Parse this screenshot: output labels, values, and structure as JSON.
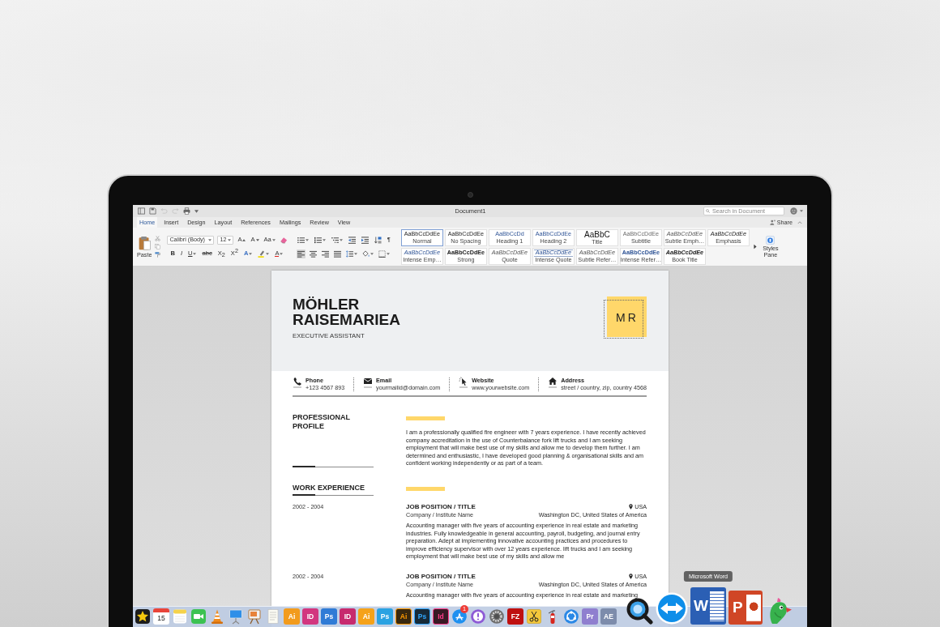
{
  "window": {
    "title": "Document1",
    "search_placeholder": "Search in Document"
  },
  "quick_access": [
    {
      "kind": "sidebar",
      "disabled": false
    },
    {
      "kind": "save",
      "disabled": false
    },
    {
      "kind": "undo",
      "disabled": true
    },
    {
      "kind": "redo",
      "disabled": true
    },
    {
      "kind": "print",
      "disabled": false
    },
    {
      "kind": "more",
      "disabled": false
    }
  ],
  "tabs": [
    {
      "label": "Home",
      "selected": true
    },
    {
      "label": "Insert",
      "selected": false
    },
    {
      "label": "Design",
      "selected": false
    },
    {
      "label": "Layout",
      "selected": false
    },
    {
      "label": "References",
      "selected": false
    },
    {
      "label": "Mailings",
      "selected": false
    },
    {
      "label": "Review",
      "selected": false
    },
    {
      "label": "View",
      "selected": false
    }
  ],
  "share": {
    "label": "Share"
  },
  "ribbon": {
    "paste_label": "Paste",
    "font_name": "Calibri (Body)",
    "font_size": "12",
    "font_row1": [
      {
        "kind": "grow",
        "label": "A"
      },
      {
        "kind": "shrink",
        "label": "A"
      },
      {
        "kind": "case",
        "label": "Aa"
      },
      {
        "kind": "clear"
      }
    ],
    "font_row2": [
      {
        "kind": "bold",
        "label": "B"
      },
      {
        "kind": "italic",
        "label": "I"
      },
      {
        "kind": "underline",
        "label": "U"
      },
      {
        "kind": "strike",
        "label": "abc"
      },
      {
        "kind": "sub",
        "label": "X$_{2}$"
      },
      {
        "kind": "sup",
        "label": "X$^{2}$"
      },
      {
        "kind": "effects",
        "label": "A"
      },
      {
        "kind": "highlight"
      },
      {
        "kind": "color",
        "label": "A"
      }
    ],
    "para_row1": [
      {
        "kind": "bullets"
      },
      {
        "kind": "numbering"
      },
      {
        "kind": "multilevel"
      },
      {
        "kind": "outdent"
      },
      {
        "kind": "indent"
      },
      {
        "kind": "sort"
      },
      {
        "kind": "pilcrow",
        "label": "¶"
      }
    ],
    "para_row2": [
      {
        "kind": "align-left",
        "selected": true
      },
      {
        "kind": "align-center",
        "selected": false
      },
      {
        "kind": "align-right",
        "selected": false
      },
      {
        "kind": "justify",
        "selected": false
      },
      {
        "kind": "spacing",
        "selected": false
      },
      {
        "kind": "shading",
        "selected": false
      },
      {
        "kind": "borders",
        "selected": false
      }
    ],
    "styles": [
      {
        "kind": "normal",
        "preview": "AaBbCcDdEe",
        "label": "Normal",
        "selected": true
      },
      {
        "kind": "normal",
        "preview": "AaBbCcDdEe",
        "label": "No Spacing",
        "selected": false
      },
      {
        "kind": "heading",
        "preview": "AaBbCcDd",
        "label": "Heading 1",
        "selected": false
      },
      {
        "kind": "heading",
        "preview": "AaBbCcDdEe",
        "label": "Heading 2",
        "selected": false
      },
      {
        "kind": "title",
        "preview": "AaBbC",
        "label": "Title",
        "selected": false
      },
      {
        "kind": "subtitle",
        "preview": "AaBbCcDdEe",
        "label": "Subtitle",
        "selected": false
      },
      {
        "kind": "subtle",
        "preview": "AaBbCcDdEe",
        "label": "Subtle Emph…",
        "selected": false
      },
      {
        "kind": "emphasis",
        "preview": "AaBbCcDdEe",
        "label": "Emphasis",
        "selected": false
      },
      {
        "kind": "intense",
        "preview": "AaBbCcDdEe",
        "label": "Intense Emp…",
        "selected": false
      },
      {
        "kind": "strong",
        "preview": "AaBbCcDdEe",
        "label": "Strong",
        "selected": false
      },
      {
        "kind": "subtle",
        "preview": "AaBbCcDdEe",
        "label": "Quote",
        "selected": false
      },
      {
        "kind": "intense-quote",
        "preview": "AaBbCcDdEe",
        "label": "Intense Quote",
        "selected": false
      },
      {
        "kind": "subtle",
        "preview": "AaBbCcDdEe",
        "label": "Subtle Refer…",
        "selected": false
      },
      {
        "kind": "intense-strong",
        "preview": "AaBbCcDdEe",
        "label": "Intense Refer…",
        "selected": false
      },
      {
        "kind": "book",
        "preview": "AaBbCcDdEe",
        "label": "Book Title",
        "selected": false
      }
    ],
    "styles_pane_label": "Styles Pane"
  },
  "resume": {
    "name": "MÖHLER RAISEMARIEA",
    "job_title": "EXECUTIVE ASSISTANT",
    "monogram": "MR",
    "contacts": [
      {
        "kind": "phone",
        "label": "Phone",
        "value": "+123 4567 893"
      },
      {
        "kind": "email",
        "label": "Email",
        "value": "yourmailid@domain.com"
      },
      {
        "kind": "website",
        "label": "Website",
        "value": "www.yourwebsite.com"
      },
      {
        "kind": "address",
        "label": "Address",
        "value": "street / country, zip, country 4568"
      }
    ],
    "profile": {
      "heading": "PROFESSIONAL PROFILE",
      "text": "I am a professionally qualified fire engineer with 7 years experience. I have recently achieved company accreditation in the use of Counterbalance fork lift trucks and I am seeking employment that will make best use of my skills and allow me to develop them further. I am determined and enthusiastic, I have developed good planning & organisational skills and am confident working independently or as part of a team."
    },
    "experience": {
      "heading": "WORK EXPERIENCE",
      "entries": [
        {
          "dates": "2002 - 2004",
          "position": "JOB POSITION / TITLE",
          "company": "Company / Institute Name",
          "country": "USA",
          "location": "Washington DC, United States of America",
          "text": "Accounting manager with five years of accounting experience in real estate and marketing industries. Fully knowledgeable in general accounting, payroll, budgeting, and journal entry preparation. Adept at implementing innovative accounting practices and procedures to improve efficiency supervisor with over 12 years experience. lift trucks and I am seeking employment that will make best use of my skills and allow me"
        },
        {
          "dates": "2002 - 2004",
          "position": "JOB POSITION / TITLE",
          "company": "Company / Institute Name",
          "country": "USA",
          "location": "Washington DC, United States of America",
          "text": "Accounting manager with five years of accounting experience in real estate and marketing"
        }
      ]
    }
  },
  "dock": {
    "items": [
      {
        "kind": "star",
        "magnified": false
      },
      {
        "kind": "calendar",
        "label": "15",
        "magnified": false
      },
      {
        "kind": "notes",
        "magnified": false
      },
      {
        "kind": "video",
        "magnified": false
      },
      {
        "kind": "cone",
        "magnified": false
      },
      {
        "kind": "presentation",
        "magnified": false
      },
      {
        "kind": "easel",
        "magnified": false
      },
      {
        "kind": "paper",
        "magnified": false
      },
      {
        "kind": "tile-solid",
        "label": "Ai",
        "color": "#f29b1d",
        "magnified": false
      },
      {
        "kind": "tile-solid",
        "label": "ID",
        "color": "#d2367f",
        "magnified": false
      },
      {
        "kind": "tile-solid",
        "label": "Ps",
        "color": "#2f7bd6",
        "magnified": false
      },
      {
        "kind": "tile-solid",
        "label": "ID",
        "color": "#c72a6e",
        "magnified": false
      },
      {
        "kind": "tile-solid",
        "label": "Ai",
        "color": "#f5a21a",
        "magnified": false
      },
      {
        "kind": "tile-solid",
        "label": "Ps",
        "color": "#2aa2e2",
        "magnified": false
      },
      {
        "kind": "tile-outline",
        "label": "Ai",
        "color": "#ff9a00",
        "magnified": false
      },
      {
        "kind": "tile-outline",
        "label": "Ps",
        "color": "#31a8ff",
        "magnified": false
      },
      {
        "kind": "tile-outline",
        "label": "Id",
        "color": "#ff3d8b",
        "magnified": false
      },
      {
        "kind": "store",
        "badge": "1",
        "magnified": false
      },
      {
        "kind": "exclaim",
        "magnified": false
      },
      {
        "kind": "gear",
        "magnified": false
      },
      {
        "kind": "tile-solid",
        "label": "FZ",
        "color": "#bf1010",
        "magnified": false
      },
      {
        "kind": "scissors",
        "magnified": false
      },
      {
        "kind": "extinguisher",
        "magnified": false
      },
      {
        "kind": "sync",
        "magnified": false
      },
      {
        "kind": "tile-solid",
        "label": "Pr",
        "color": "#8f7fcf",
        "magnified": false
      },
      {
        "kind": "tile-solid",
        "label": "AE",
        "color": "#7d8cab",
        "magnified": false
      },
      {
        "kind": "lens",
        "magnified": true
      },
      {
        "kind": "arrows",
        "magnified": true
      },
      {
        "kind": "doc",
        "label": "W",
        "magnified": true,
        "tooltip": "Microsoft Word"
      },
      {
        "kind": "slides",
        "label": "P",
        "magnified": true
      },
      {
        "kind": "bird",
        "magnified": true
      }
    ]
  }
}
